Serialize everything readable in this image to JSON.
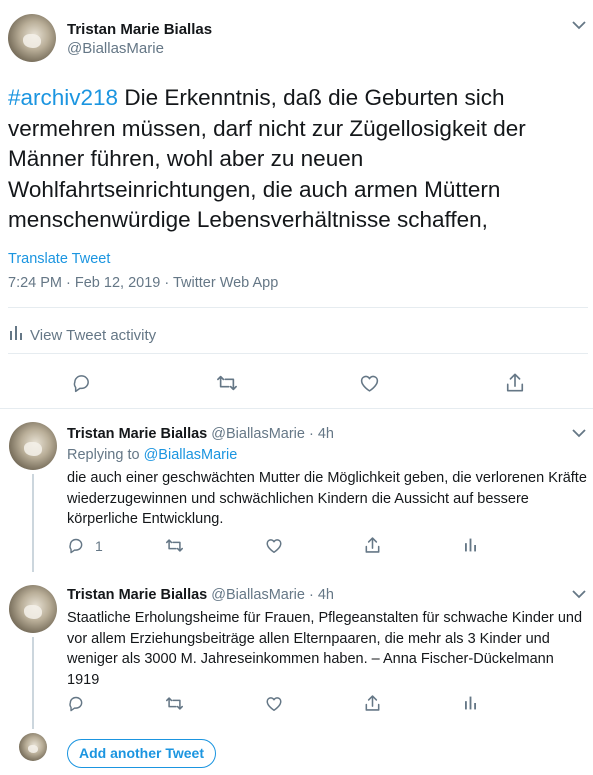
{
  "main_tweet": {
    "author_name": "Tristan Marie Biallas",
    "handle": "@BiallasMarie",
    "hashtag": "#archiv218",
    "text": " Die Erkenntnis, daß die Geburten sich vermehren müssen, darf nicht zur Zügellosigkeit der Männer führen, wohl aber zu neuen Wohlfahrtseinrichtungen, die auch armen Müttern menschenwürdige Lebensverhältnisse schaffen,",
    "translate_label": "Translate Tweet",
    "meta": "7:24 PM · Feb 12, 2019 · Twitter Web App",
    "activity_label": "View Tweet activity"
  },
  "replies": [
    {
      "author_name": "Tristan Marie Biallas",
      "handle_time": "@BiallasMarie · 4h",
      "replying_prefix": "Replying to ",
      "replying_handle": "@BiallasMarie",
      "text": "die auch einer geschwächten Mutter die Möglichkeit geben, die verlorenen Kräfte wiederzugewinnen und schwächlichen Kindern die Aussicht auf bessere körperliche Entwicklung.",
      "reply_count": "1"
    },
    {
      "author_name": "Tristan Marie Biallas",
      "handle_time": "@BiallasMarie · 4h",
      "text": "Staatliche Erholungsheime für Frauen, Pflegeanstalten für schwache Kinder und vor allem Erziehungsbeiträge allen Elternpaaren, die mehr als 3 Kinder und weniger als 3000 M. Jahreseinkommen haben. – Anna Fischer-Dückelmann 1919"
    }
  ],
  "add_tweet_label": "Add another Tweet",
  "colors": {
    "accent": "#1b95e0",
    "secondary": "#657786",
    "divider": "#e6ecf0"
  }
}
